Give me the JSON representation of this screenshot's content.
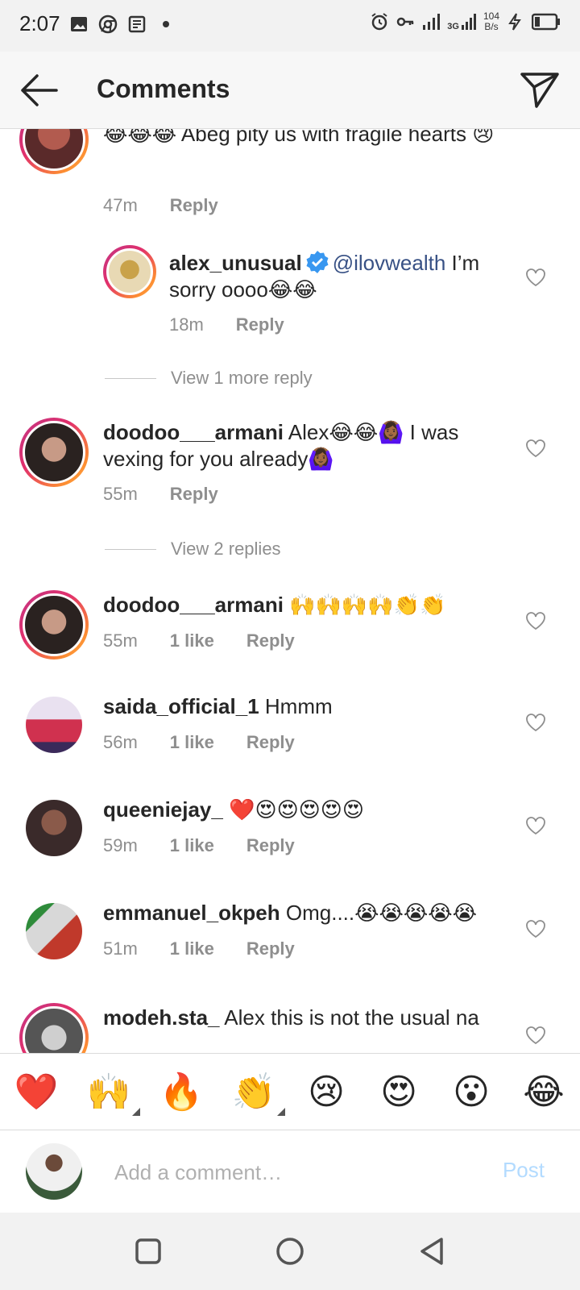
{
  "status_bar": {
    "time": "2:07",
    "net_speed_value": "104",
    "net_speed_unit": "B/s",
    "network": "3G",
    "icons_left": [
      "image-icon",
      "chrome-icon",
      "news-icon",
      "dot-icon"
    ],
    "icons_right": [
      "alarm-icon",
      "key-icon",
      "signal-icon",
      "signal-3g-icon",
      "charging-icon",
      "battery-icon"
    ]
  },
  "header": {
    "title": "Comments"
  },
  "comments": [
    {
      "user": "",
      "text": "😂😂😂 Abeg pity us with fragile hearts 😢",
      "time": "47m",
      "likes": "",
      "reply": "Reply"
    },
    {
      "user": "alex_unusual",
      "verified": true,
      "mention": "@ilovwealth",
      "text": " I’m sorry oooo😂😂",
      "time": "18m",
      "likes": "",
      "reply": "Reply"
    },
    {
      "user": "doodoo___armani",
      "text": "Alex😂😂🙆🏾‍♀️ I was vexing for you already🙆🏾‍♀️",
      "time": "55m",
      "likes": "",
      "reply": "Reply"
    },
    {
      "user": "doodoo___armani",
      "text": "🙌🙌🙌🙌👏👏",
      "time": "55m",
      "likes": "1 like",
      "reply": "Reply"
    },
    {
      "user": "saida_official_1",
      "text": "Hmmm",
      "time": "56m",
      "likes": "1 like",
      "reply": "Reply"
    },
    {
      "user": "queeniejay_",
      "text": "❤️😍😍😍😍😍",
      "time": "59m",
      "likes": "1 like",
      "reply": "Reply"
    },
    {
      "user": "emmanuel_okpeh",
      "text": "Omg....😭😭😭😭😭",
      "time": "51m",
      "likes": "1 like",
      "reply": "Reply"
    },
    {
      "user": "modeh.sta_",
      "text": "Alex this is not the usual na",
      "time": "",
      "likes": "",
      "reply": ""
    }
  ],
  "view_more": {
    "first": "View 1 more reply",
    "second": "View 2 replies"
  },
  "emoji_bar": [
    "❤️",
    "🙌",
    "🔥",
    "👏",
    "😢",
    "😍",
    "😮",
    "😂"
  ],
  "composer": {
    "placeholder": "Add a comment…",
    "post_label": "Post"
  },
  "colors": {
    "accent_link": "#385185",
    "post_disabled": "#b3dbff",
    "meta_gray": "#8e8e8e",
    "verified_blue": "#3897f0"
  }
}
